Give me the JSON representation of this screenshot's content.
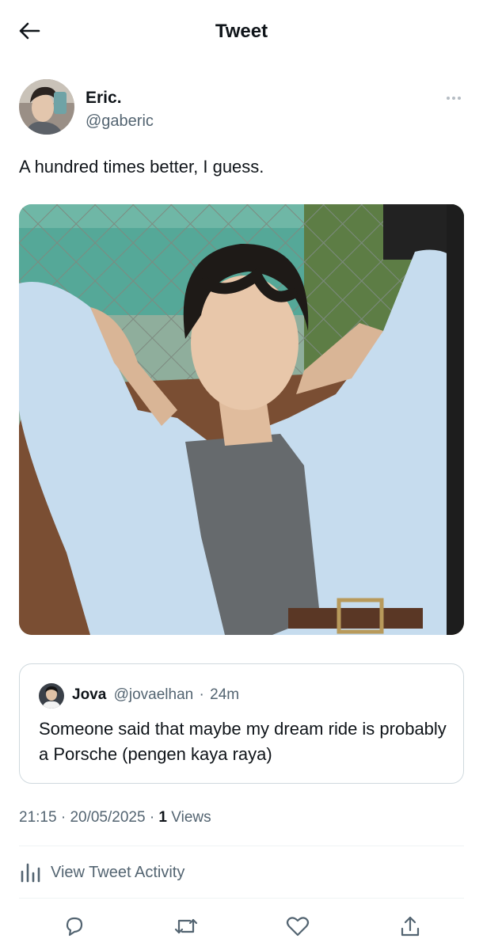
{
  "header": {
    "title": "Tweet",
    "back_icon": "arrow-left-icon"
  },
  "author": {
    "name": "Eric.",
    "handle": "@gaberic",
    "more_icon": "more-dots-icon"
  },
  "tweet": {
    "text": "A hundred times better, I guess."
  },
  "quote": {
    "name": "Jova",
    "handle": "@jovaelhan",
    "separator": "·",
    "time": "24m",
    "text": "Someone said that maybe my dream ride is probably a Porsche (pengen kaya raya)"
  },
  "meta": {
    "time": "21:15",
    "separator": "·",
    "date": "20/05/2025",
    "views_count": "1",
    "views_label": "Views"
  },
  "activity": {
    "label": "View Tweet Activity",
    "icon": "bar-chart-icon"
  },
  "actions": [
    "reply-icon",
    "retweet-icon",
    "like-icon",
    "share-icon"
  ],
  "colors": {
    "text": "#0f1419",
    "secondary": "#536471",
    "border": "#cfd9de",
    "divider": "#eff3f4"
  }
}
